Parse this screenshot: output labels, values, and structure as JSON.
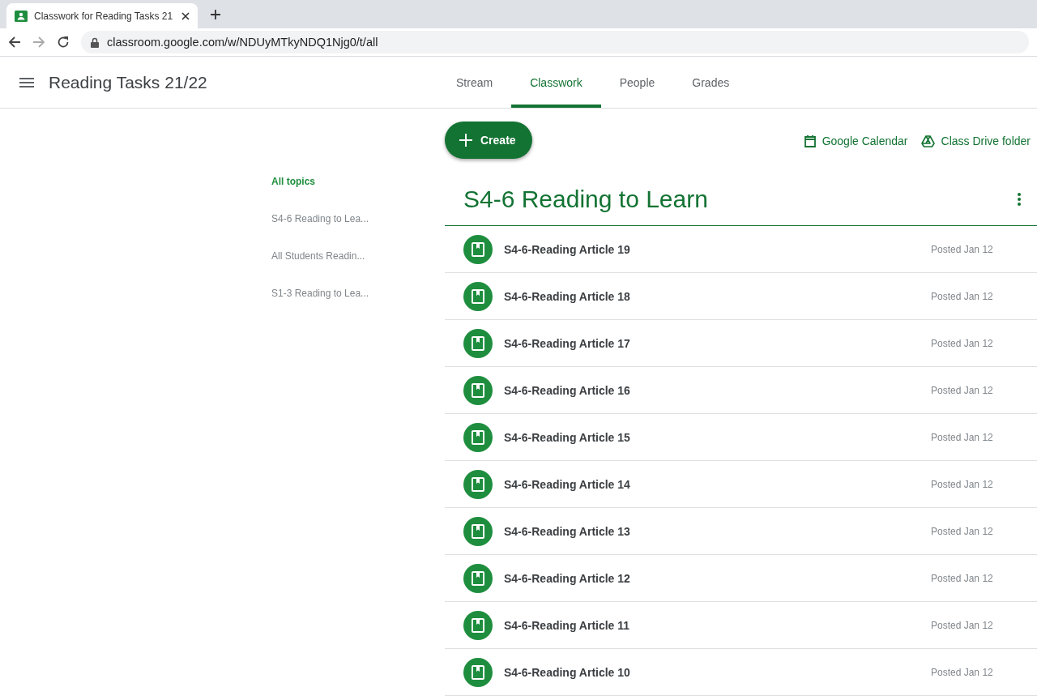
{
  "browser": {
    "tab": {
      "title": "Classwork for Reading Tasks 21",
      "selected": true
    },
    "address": "classroom.google.com/w/NDUyMTkyNDQ1Njg0/t/all"
  },
  "header": {
    "class_name": "Reading Tasks 21/22",
    "tabs": [
      {
        "label": "Stream",
        "selected": false
      },
      {
        "label": "Classwork",
        "selected": true
      },
      {
        "label": "People",
        "selected": false
      },
      {
        "label": "Grades",
        "selected": false
      }
    ]
  },
  "create_button": "Create",
  "links": [
    {
      "kind": "calendar",
      "label": "Google Calendar"
    },
    {
      "kind": "drive",
      "label": "Class Drive folder"
    }
  ],
  "topics": [
    {
      "label": "All topics",
      "selected": true
    },
    {
      "label": "S4-6 Reading to Lea...",
      "selected": false
    },
    {
      "label": "All Students Readin...",
      "selected": false
    },
    {
      "label": "S1-3 Reading to Lea...",
      "selected": false
    }
  ],
  "section": {
    "title": "S4-6 Reading to Learn",
    "items": [
      {
        "title": "S4-6-Reading Article 19",
        "posted": "Posted Jan 12"
      },
      {
        "title": "S4-6-Reading Article 18",
        "posted": "Posted Jan 12"
      },
      {
        "title": "S4-6-Reading Article 17",
        "posted": "Posted Jan 12"
      },
      {
        "title": "S4-6-Reading Article 16",
        "posted": "Posted Jan 12"
      },
      {
        "title": "S4-6-Reading Article 15",
        "posted": "Posted Jan 12"
      },
      {
        "title": "S4-6-Reading Article 14",
        "posted": "Posted Jan 12"
      },
      {
        "title": "S4-6-Reading Article 13",
        "posted": "Posted Jan 12"
      },
      {
        "title": "S4-6-Reading Article 12",
        "posted": "Posted Jan 12"
      },
      {
        "title": "S4-6-Reading Article 11",
        "posted": "Posted Jan 12"
      },
      {
        "title": "S4-6-Reading Article 10",
        "posted": "Posted Jan 12"
      }
    ]
  }
}
